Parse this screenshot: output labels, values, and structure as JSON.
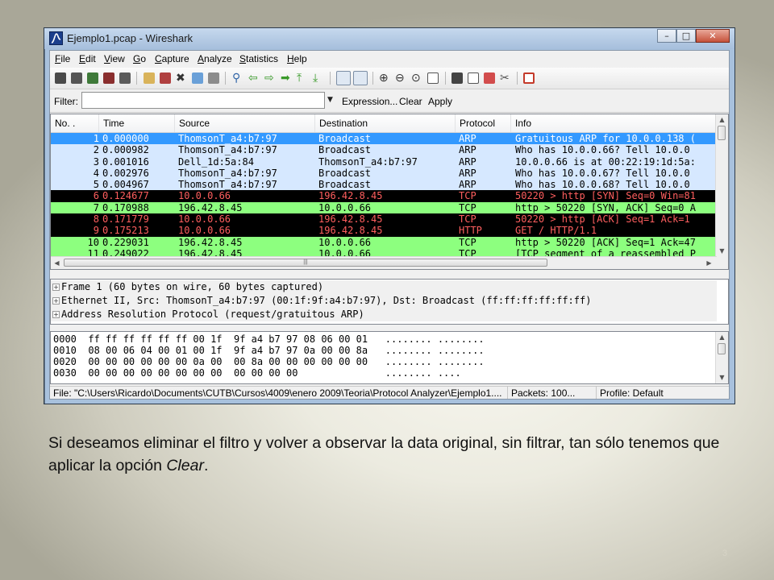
{
  "window": {
    "title": "Ejemplo1.pcap - Wireshark",
    "controls": {
      "minimize": "–",
      "maximize": "□",
      "close": "✕"
    }
  },
  "menu": [
    "File",
    "Edit",
    "View",
    "Go",
    "Capture",
    "Analyze",
    "Statistics",
    "Help"
  ],
  "filter": {
    "label": "Filter:",
    "value": "",
    "expression_button": "Expression...",
    "clear_button": "Clear",
    "apply_button": "Apply"
  },
  "packet_list": {
    "columns": [
      "No. .",
      "Time",
      "Source",
      "Destination",
      "Protocol",
      "Info"
    ],
    "rows": [
      {
        "no": "1",
        "time": "0.000000",
        "src": "ThomsonT_a4:b7:97",
        "dst": "Broadcast",
        "proto": "ARP",
        "info": "Gratuitous ARP for 10.0.0.138 (",
        "bg": "#3399ff",
        "fg": "#ffffff"
      },
      {
        "no": "2",
        "time": "0.000982",
        "src": "ThomsonT_a4:b7:97",
        "dst": "Broadcast",
        "proto": "ARP",
        "info": "Who has 10.0.0.66?  Tell 10.0.0",
        "bg": "#d6e8ff",
        "fg": "#000000"
      },
      {
        "no": "3",
        "time": "0.001016",
        "src": "Dell_1d:5a:84",
        "dst": "ThomsonT_a4:b7:97",
        "proto": "ARP",
        "info": "10.0.0.66 is at 00:22:19:1d:5a:",
        "bg": "#d6e8ff",
        "fg": "#000000"
      },
      {
        "no": "4",
        "time": "0.002976",
        "src": "ThomsonT_a4:b7:97",
        "dst": "Broadcast",
        "proto": "ARP",
        "info": "Who has 10.0.0.67?  Tell 10.0.0",
        "bg": "#d6e8ff",
        "fg": "#000000"
      },
      {
        "no": "5",
        "time": "0.004967",
        "src": "ThomsonT_a4:b7:97",
        "dst": "Broadcast",
        "proto": "ARP",
        "info": "Who has 10.0.0.68?  Tell 10.0.0",
        "bg": "#d6e8ff",
        "fg": "#000000"
      },
      {
        "no": "6",
        "time": "0.124677",
        "src": "10.0.0.66",
        "dst": "196.42.8.45",
        "proto": "TCP",
        "info": "50220 > http [SYN] Seq=0 Win=81",
        "bg": "#000000",
        "fg": "#ff5f5f"
      },
      {
        "no": "7",
        "time": "0.170988",
        "src": "196.42.8.45",
        "dst": "10.0.0.66",
        "proto": "TCP",
        "info": "http > 50220 [SYN, ACK] Seq=0 A",
        "bg": "#8dff7f",
        "fg": "#000000"
      },
      {
        "no": "8",
        "time": "0.171779",
        "src": "10.0.0.66",
        "dst": "196.42.8.45",
        "proto": "TCP",
        "info": "50220 > http [ACK] Seq=1 Ack=1",
        "bg": "#000000",
        "fg": "#ff5f5f"
      },
      {
        "no": "9",
        "time": "0.175213",
        "src": "10.0.0.66",
        "dst": "196.42.8.45",
        "proto": "HTTP",
        "info": "GET / HTTP/1.1",
        "bg": "#000000",
        "fg": "#ff5f5f"
      },
      {
        "no": "10",
        "time": "0.229031",
        "src": "196.42.8.45",
        "dst": "10.0.0.66",
        "proto": "TCP",
        "info": "http > 50220 [ACK] Seq=1 Ack=47",
        "bg": "#8dff7f",
        "fg": "#000000"
      },
      {
        "no": "11",
        "time": "0.249022",
        "src": "196.42.8.45",
        "dst": "10.0.0.66",
        "proto": "TCP",
        "info": "[TCP segment of a reassembled P",
        "bg": "#8dff7f",
        "fg": "#000000"
      }
    ]
  },
  "details": [
    "Frame 1 (60 bytes on wire, 60 bytes captured)",
    "Ethernet II, Src: ThomsonT_a4:b7:97 (00:1f:9f:a4:b7:97), Dst: Broadcast (ff:ff:ff:ff:ff:ff)",
    "Address Resolution Protocol (request/gratuitous ARP)"
  ],
  "hex": [
    "0000  ff ff ff ff ff ff 00 1f  9f a4 b7 97 08 06 00 01   ........ ........",
    "0010  08 00 06 04 00 01 00 1f  9f a4 b7 97 0a 00 00 8a   ........ ........",
    "0020  00 00 00 00 00 00 0a 00  00 8a 00 00 00 00 00 00   ........ ........",
    "0030  00 00 00 00 00 00 00 00  00 00 00 00               ........ ...."
  ],
  "status": {
    "file": "File: \"C:\\Users\\Ricardo\\Documents\\CUTB\\Cursos\\4009\\enero 2009\\Teoria\\Protocol Analyzer\\Ejemplo1....",
    "packets": "Packets: 100...",
    "profile": "Profile: Default"
  },
  "caption": {
    "text": "Si deseamos eliminar el filtro y volver a observar la data original, sin filtrar, tan sólo tenemos que aplicar la opción ",
    "emphasis": "Clear",
    "end": "."
  },
  "slide_number": "3",
  "toolbar_icons": [
    "interface-list-icon",
    "capture-options-icon",
    "start-capture-icon",
    "stop-capture-icon",
    "restart-capture-icon",
    "open-file-icon",
    "save-file-icon",
    "close-file-icon",
    "reload-icon",
    "print-icon",
    "find-packet-icon",
    "go-back-icon",
    "go-forward-icon",
    "go-to-packet-icon",
    "go-first-icon",
    "go-last-icon",
    "colorize-icon",
    "auto-scroll-icon",
    "zoom-in-icon",
    "zoom-out-icon",
    "normal-size-icon",
    "resize-columns-icon",
    "capture-filters-icon",
    "display-filters-icon",
    "coloring-rules-icon",
    "preferences-icon",
    "help-icon"
  ]
}
